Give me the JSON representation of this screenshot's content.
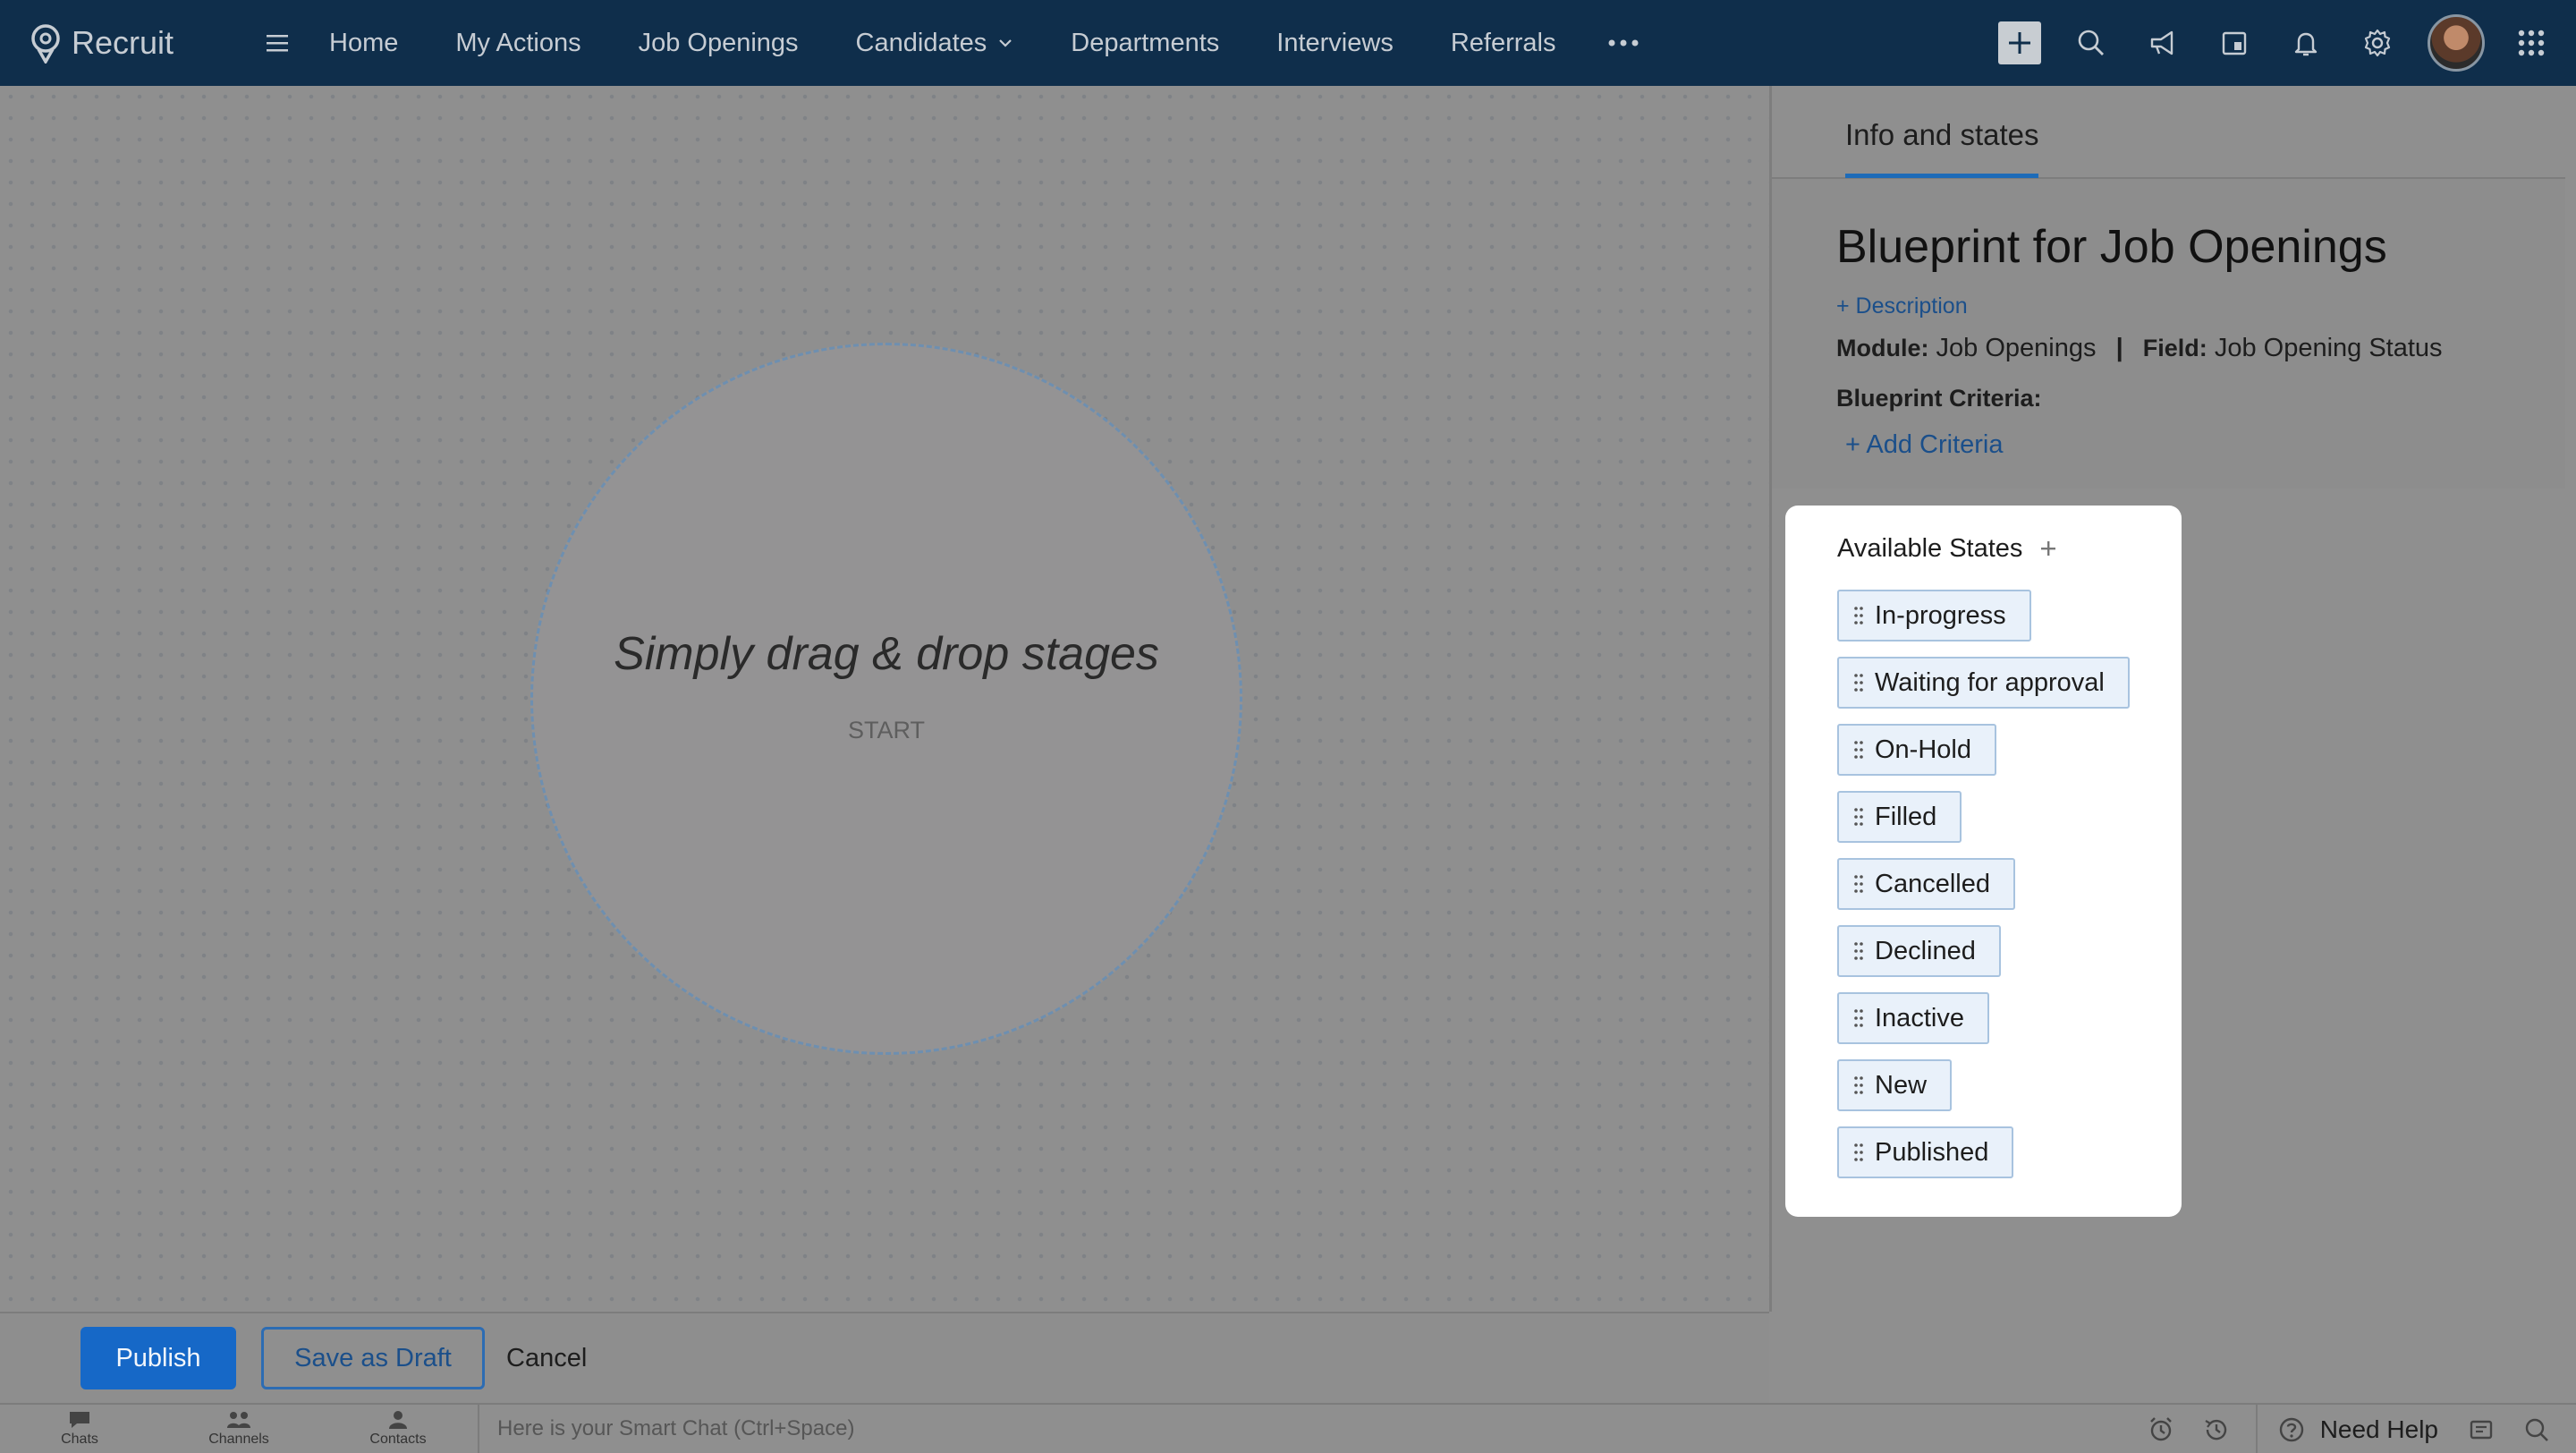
{
  "app": {
    "name": "Recruit"
  },
  "nav": {
    "items": [
      {
        "label": "Home"
      },
      {
        "label": "My Actions"
      },
      {
        "label": "Job Openings"
      },
      {
        "label": "Candidates"
      },
      {
        "label": "Departments"
      },
      {
        "label": "Interviews"
      },
      {
        "label": "Referrals"
      }
    ]
  },
  "canvas": {
    "title": "Simply drag & drop stages",
    "start_label": "START"
  },
  "panel": {
    "tab_label": "Info and states",
    "blueprint_title": "Blueprint for Job Openings",
    "add_description": "+ Description",
    "module_label": "Module:",
    "module_value": "Job Openings",
    "separator": "|",
    "field_label": "Field:",
    "field_value": "Job Opening Status",
    "criteria_label": "Blueprint Criteria:",
    "add_criteria": "+ Add Criteria"
  },
  "states": {
    "heading": "Available States",
    "items": [
      {
        "label": "In-progress"
      },
      {
        "label": "Waiting for approval"
      },
      {
        "label": "On-Hold"
      },
      {
        "label": "Filled"
      },
      {
        "label": "Cancelled"
      },
      {
        "label": "Declined"
      },
      {
        "label": "Inactive"
      },
      {
        "label": "New"
      },
      {
        "label": "Published"
      }
    ]
  },
  "actions": {
    "publish": "Publish",
    "save_draft": "Save as Draft",
    "cancel": "Cancel"
  },
  "footer": {
    "tabs": [
      {
        "label": "Chats"
      },
      {
        "label": "Channels"
      },
      {
        "label": "Contacts"
      }
    ],
    "smartchat_placeholder": "Here is your Smart Chat (Ctrl+Space)",
    "need_help": "Need Help"
  },
  "colors": {
    "topbar": "#0f2e4b",
    "accent": "#1668c7",
    "state_pill_bg": "#e9f1fa",
    "state_pill_border": "#a8c3df"
  }
}
